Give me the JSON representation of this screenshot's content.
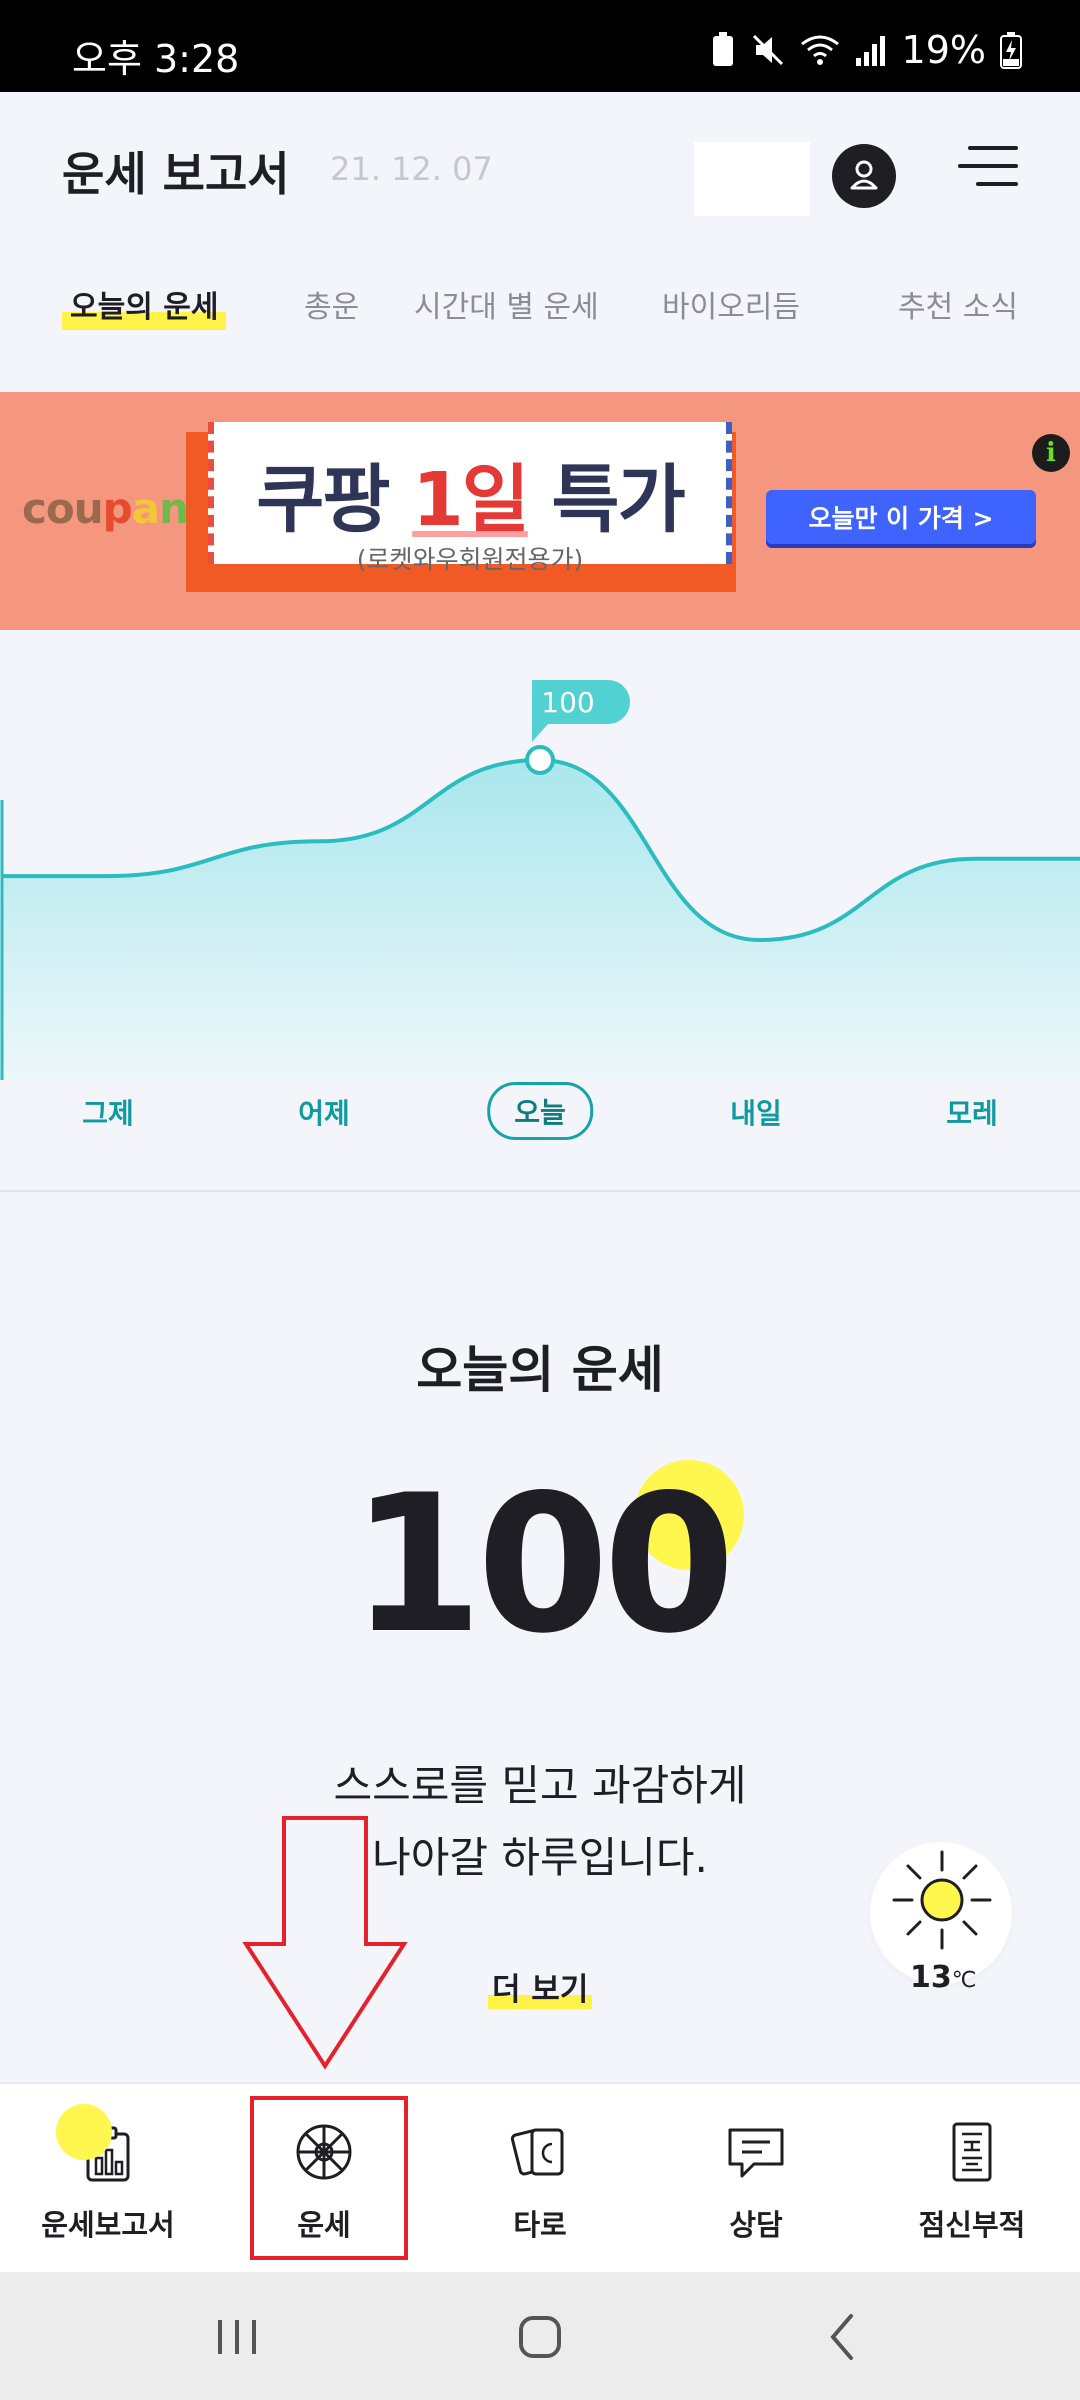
{
  "status_bar": {
    "time": "오후 3:28",
    "battery": "19%"
  },
  "header": {
    "title": "운세 보고서",
    "date": "21. 12. 07"
  },
  "tabs": [
    {
      "label": "오늘의 운세",
      "active": true
    },
    {
      "label": "총운",
      "active": false
    },
    {
      "label": "시간대 별 운세",
      "active": false
    },
    {
      "label": "바이오리듬",
      "active": false
    },
    {
      "label": "추천 소식",
      "active": false
    }
  ],
  "ad": {
    "brand": "coupang",
    "headline_pre": "쿠팡 ",
    "headline_highlight": "1일",
    "headline_post": " 특가",
    "sub": "(로켓와우회원전용가)",
    "button": "오늘만 이 가격 >",
    "info_icon": "i"
  },
  "chart_data": {
    "type": "area",
    "categories": [
      "그제",
      "어제",
      "오늘",
      "내일",
      "모레"
    ],
    "values": [
      60,
      72,
      100,
      38,
      66
    ],
    "highlight_label": "100",
    "selected_index": 2,
    "colors": {
      "line": "#2bbcbf",
      "fill": "#a9e7ec",
      "label_bg": "#52d1d3"
    }
  },
  "fortune": {
    "title": "오늘의  운세",
    "score": "100",
    "desc_line1": "스스로를 믿고 과감하게",
    "desc_line2": "나아갈 하루입니다.",
    "more": "더 보기"
  },
  "weather": {
    "temp": "13",
    "unit": "℃",
    "icon": "sun-icon"
  },
  "bottom_nav": [
    {
      "label": "운세보고서",
      "icon": "report-icon"
    },
    {
      "label": "운세",
      "icon": "wheel-icon"
    },
    {
      "label": "타로",
      "icon": "tarot-icon"
    },
    {
      "label": "상담",
      "icon": "chat-icon"
    },
    {
      "label": "점신부적",
      "icon": "talisman-icon"
    }
  ],
  "colors": {
    "highlight": "#fff34a",
    "accent": "#14a3a6",
    "annotation": "#e5212b"
  }
}
